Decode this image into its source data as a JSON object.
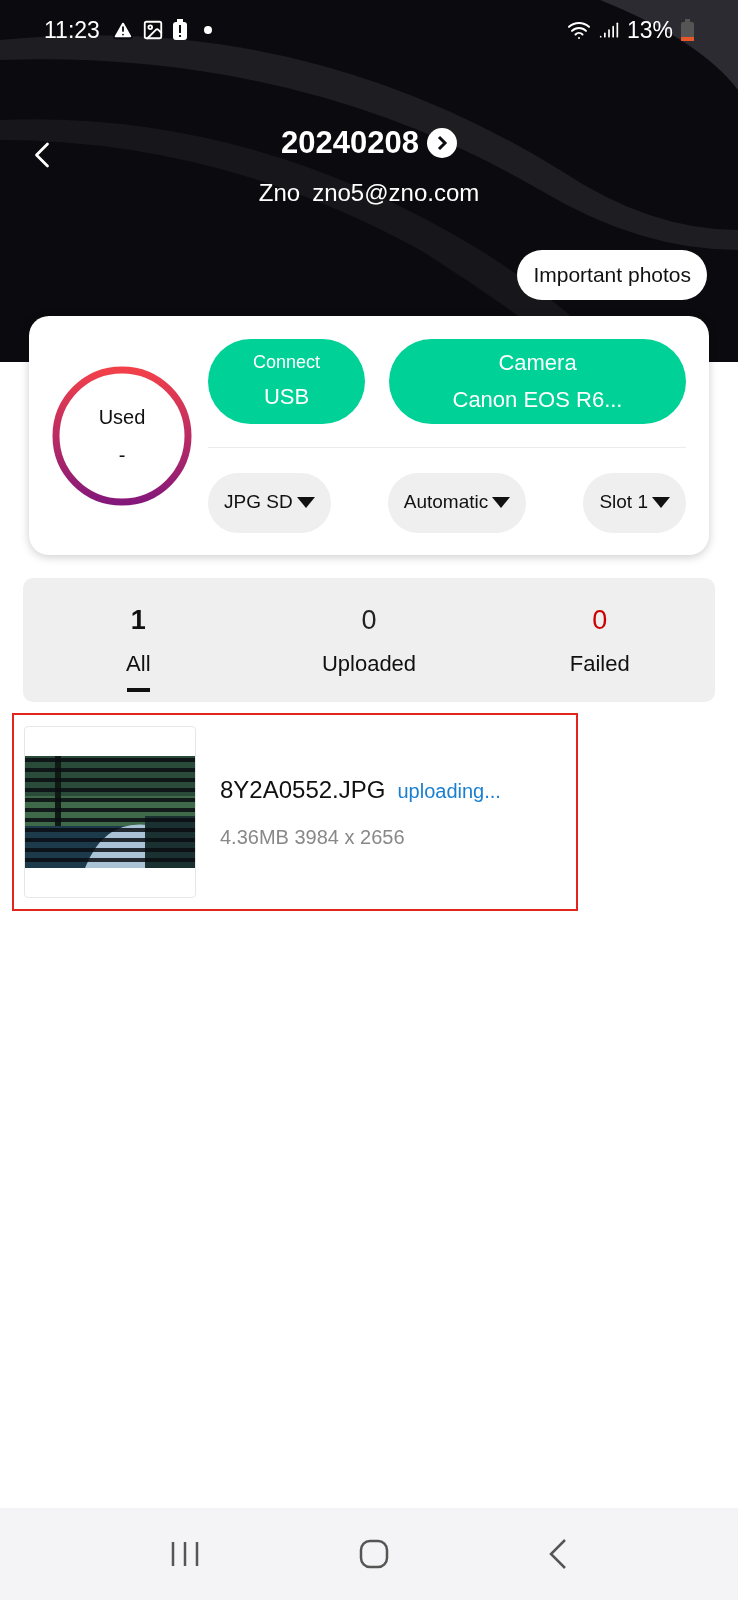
{
  "status_bar": {
    "time": "11:23",
    "battery": "13%"
  },
  "header": {
    "title": "20240208",
    "user_name": "Zno",
    "email": "zno5@zno.com",
    "action": "Important photos"
  },
  "card": {
    "usage": {
      "label": "Used",
      "value": "-"
    },
    "connect": {
      "label": "Connect",
      "value": "USB"
    },
    "camera": {
      "label": "Camera",
      "value": "Canon EOS R6..."
    },
    "dropdowns": [
      {
        "label": "JPG SD"
      },
      {
        "label": "Automatic"
      },
      {
        "label": "Slot 1"
      }
    ]
  },
  "tabs": [
    {
      "count": "1",
      "label": "All",
      "selected": true,
      "color": "#111111"
    },
    {
      "count": "0",
      "label": "Uploaded",
      "selected": false,
      "color": "#222222"
    },
    {
      "count": "0",
      "label": "Failed",
      "selected": false,
      "color": "#cc0000"
    }
  ],
  "files": [
    {
      "name": "8Y2A0552.JPG",
      "status": "uploading...",
      "details": "4.36MB 3984 x 2656",
      "kind": "picture"
    }
  ]
}
